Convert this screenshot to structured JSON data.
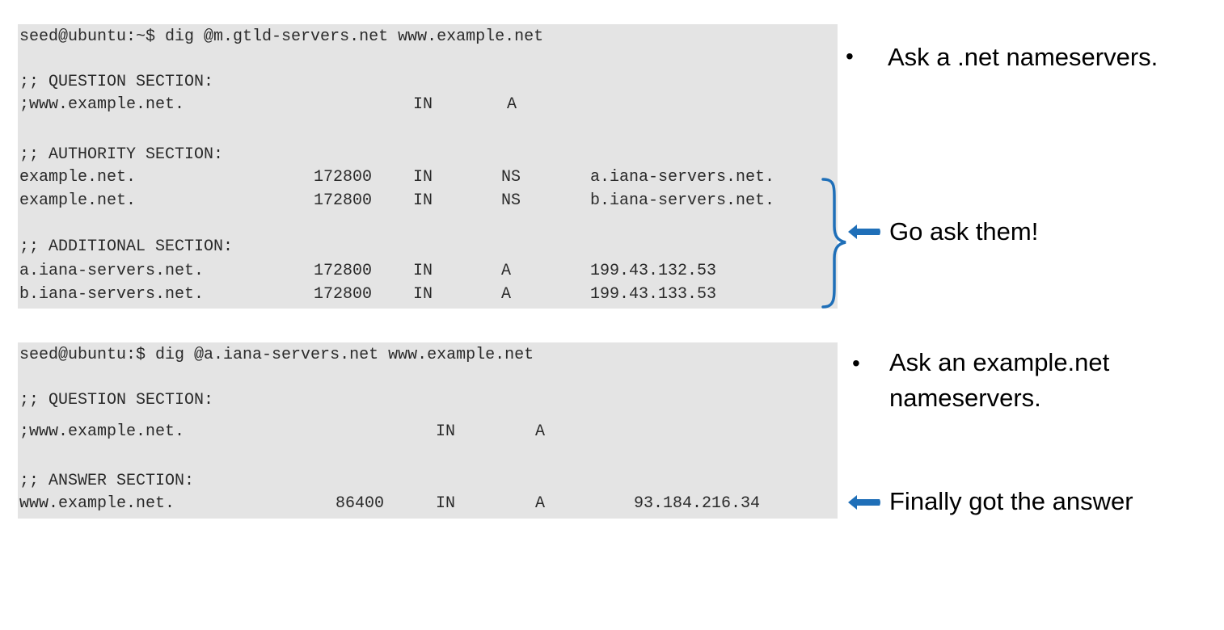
{
  "terminal1": {
    "prompt": "seed@ubuntu:~$ dig @m.gtld-servers.net www.example.net",
    "question_header": ";; QUESTION SECTION:",
    "question": [
      ";www.example.net.",
      "IN",
      "A"
    ],
    "authority_header": ";; AUTHORITY SECTION:",
    "authority": [
      [
        "example.net.",
        "172800",
        "IN",
        "NS",
        "a.iana-servers.net."
      ],
      [
        "example.net.",
        "172800",
        "IN",
        "NS",
        "b.iana-servers.net."
      ]
    ],
    "additional_header": ";; ADDITIONAL SECTION:",
    "additional": [
      [
        "a.iana-servers.net.",
        "172800",
        "IN",
        "A",
        "199.43.132.53"
      ],
      [
        "b.iana-servers.net.",
        "172800",
        "IN",
        "A",
        "199.43.133.53"
      ]
    ]
  },
  "terminal2": {
    "prompt": "seed@ubuntu:$ dig @a.iana-servers.net www.example.net",
    "question_header": ";; QUESTION SECTION:",
    "question": [
      ";www.example.net.",
      "IN",
      "A"
    ],
    "answer_header": ";; ANSWER SECTION:",
    "answer": [
      [
        "www.example.net.",
        "86400",
        "IN",
        "A",
        "93.184.216.34"
      ]
    ]
  },
  "annotations": {
    "bullet_glyph": "•",
    "note1": "Ask a .net nameservers.",
    "note2": "Go ask them!",
    "note3_line1": "Ask an example.net",
    "note3_line2": "nameservers.",
    "note4": "Finally got the answer"
  },
  "colors": {
    "terminal_bg": "#e4e4e4",
    "terminal_text": "#2a2a2a",
    "accent_blue": "#1f6fb8"
  }
}
